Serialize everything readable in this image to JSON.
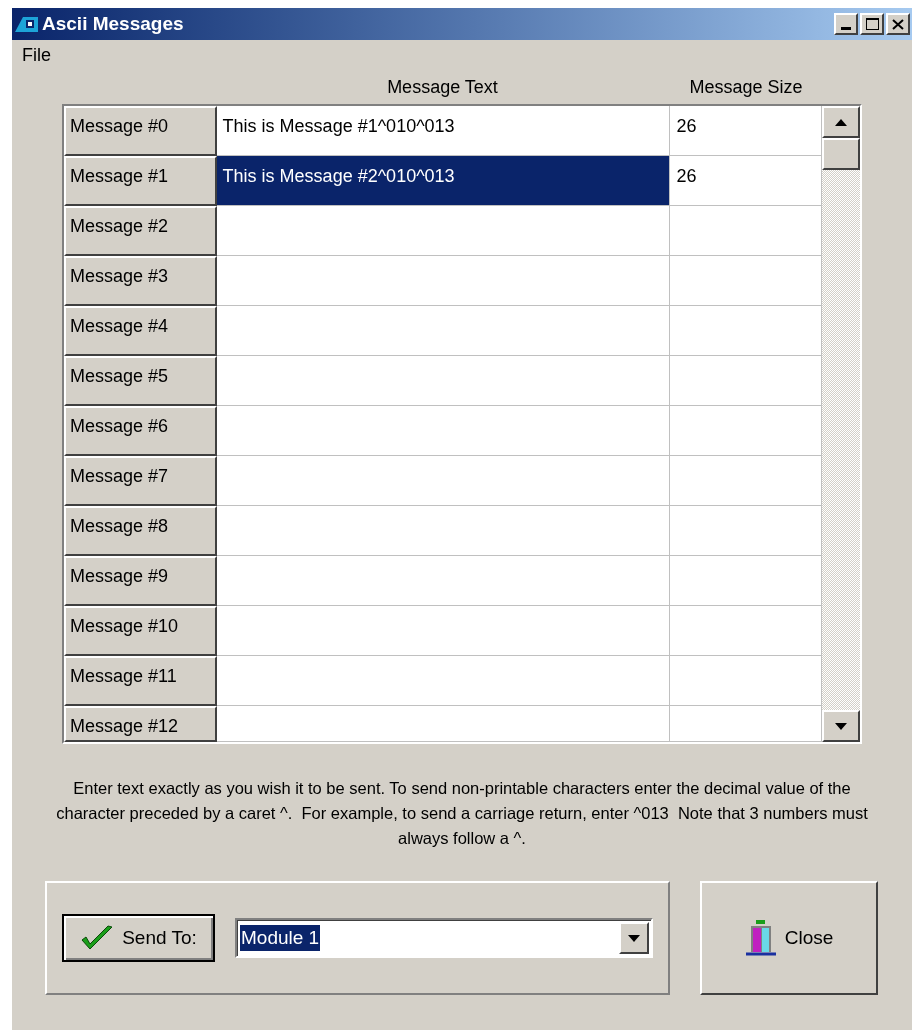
{
  "window": {
    "title": "Ascii Messages"
  },
  "menu": [
    "File"
  ],
  "grid": {
    "columns": [
      "Message Text",
      "Message Size"
    ],
    "rows": [
      {
        "header": "Message #0",
        "text": "This is Message #1^010^013",
        "size": "26",
        "selected": false
      },
      {
        "header": "Message #1",
        "text": "This is Message #2^010^013",
        "size": "26",
        "selected": true
      },
      {
        "header": "Message #2",
        "selected": false
      },
      {
        "header": "Message #3",
        "selected": false
      },
      {
        "header": "Message #4",
        "selected": false
      },
      {
        "header": "Message #5",
        "selected": false
      },
      {
        "header": "Message #6",
        "selected": false
      },
      {
        "header": "Message #7",
        "selected": false
      },
      {
        "header": "Message #8",
        "selected": false
      },
      {
        "header": "Message #9",
        "selected": false
      },
      {
        "header": "Message #10",
        "selected": false
      },
      {
        "header": "Message #11",
        "selected": false
      },
      {
        "header": "Message #12",
        "selected": false
      }
    ]
  },
  "instructions": "Enter text exactly as you wish it to be sent. To send non-printable characters enter the decimal value of the character preceded by a caret ^.  For example, to send a carriage return, enter ^013  Note that 3 numbers must always follow a ^.",
  "send_button": "Send To:",
  "target": {
    "value": "Module 1"
  },
  "close_button": "Close"
}
